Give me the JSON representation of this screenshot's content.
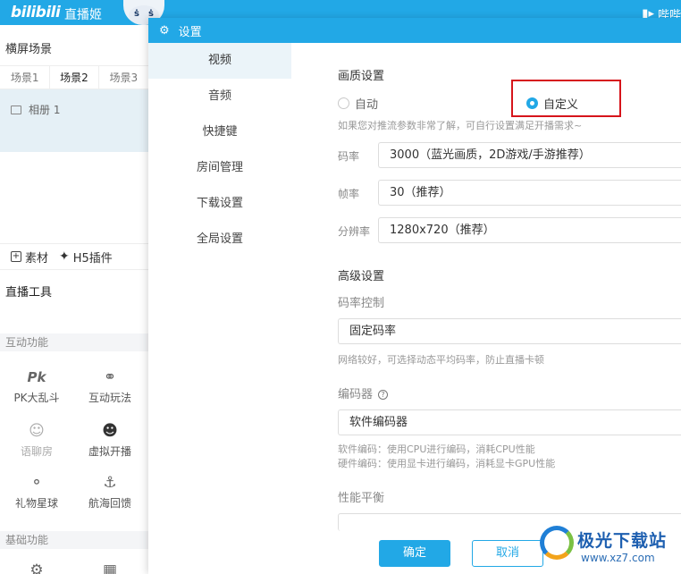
{
  "topbar": {
    "logo": "bilibili",
    "app_title": "直播姬",
    "right_text": "哔哔",
    "volume_icon": "speaker-icon"
  },
  "left": {
    "scene_title": "横屏场景",
    "scene_tabs": [
      "场景1",
      "场景2",
      "场景3"
    ],
    "scene_items": [
      "相册 1"
    ],
    "toolbar": {
      "material": "素材",
      "h5_plugin": "H5插件"
    },
    "tools_title": "直播工具",
    "section_interactive": "互动功能",
    "tools": [
      {
        "label": "PK大乱斗",
        "icon": "pk-icon"
      },
      {
        "label": "互动玩法",
        "icon": "planet-icon"
      },
      {
        "label": "语聊房",
        "icon": "users-icon"
      },
      {
        "label": "虚拟开播",
        "icon": "avatar-icon"
      },
      {
        "label": "礼物星球",
        "icon": "saturn-icon"
      },
      {
        "label": "航海回馈",
        "icon": "anchor-icon"
      }
    ],
    "section_basic": "基础功能"
  },
  "dialog": {
    "title": "设置",
    "nav": [
      "视频",
      "音频",
      "快捷键",
      "房间管理",
      "下载设置",
      "全局设置"
    ],
    "active_nav": "视频",
    "quality": {
      "title": "画质设置",
      "option_auto": "自动",
      "option_custom": "自定义",
      "selected": "自定义",
      "hint": "如果您对推流参数非常了解，可自行设置满足开播需求~",
      "bitrate_label": "码率",
      "bitrate_value": "3000（蓝光画质，2D游戏/手游推荐）",
      "fps_label": "帧率",
      "fps_value": "30（推荐）",
      "resolution_label": "分辨率",
      "resolution_value": "1280x720（推荐）"
    },
    "advanced": {
      "title": "高级设置",
      "rate_control_label": "码率控制",
      "rate_control_value": "固定码率",
      "rate_control_hint": "网络较好，可选择动态平均码率，防止直播卡顿",
      "encoder_label": "编码器",
      "encoder_value": "软件编码器",
      "encoder_hint_1": "软件编码：使用CPU进行编码，消耗CPU性能",
      "encoder_hint_2": "硬件编码：使用显卡进行编码，消耗显卡GPU性能",
      "performance_label": "性能平衡"
    },
    "ok_label": "确定",
    "cancel_label": "取消"
  },
  "watermark": {
    "name": "极光下载站",
    "url": "www.xz7.com"
  },
  "colors": {
    "accent": "#22a8e6",
    "highlight_box": "#d6141b"
  }
}
